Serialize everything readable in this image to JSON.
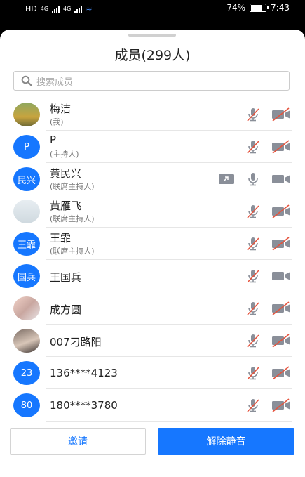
{
  "status_bar": {
    "left_items": [
      "HD",
      "4G",
      "4G"
    ],
    "battery": "74%",
    "time": "7:43"
  },
  "header": {
    "title": "成员(299人)"
  },
  "search": {
    "placeholder": "搜索成员"
  },
  "members": [
    {
      "name": "梅洁",
      "role": "(我)",
      "avatar": "photo-landscape",
      "mic": "muted",
      "camera": "off",
      "sharing": false
    },
    {
      "name": "P",
      "role": "(主持人)",
      "avatar_text": "P",
      "mic": "muted",
      "camera": "off",
      "sharing": false
    },
    {
      "name": "黄民兴",
      "role": "(联席主持人)",
      "avatar_text": "民兴",
      "mic": "on",
      "camera": "on",
      "sharing": true
    },
    {
      "name": "黄雁飞",
      "role": "(联席主持人)",
      "avatar": "photo-mountain",
      "mic": "muted",
      "camera": "off",
      "sharing": false
    },
    {
      "name": "王霏",
      "role": "(联席主持人)",
      "avatar_text": "王霏",
      "mic": "muted",
      "camera": "off",
      "sharing": false
    },
    {
      "name": "王国兵",
      "role": "",
      "avatar_text": "国兵",
      "mic": "muted",
      "camera": "on",
      "sharing": false
    },
    {
      "name": " 成方圆",
      "role": "",
      "avatar": "photo-girl",
      "mic": "muted",
      "camera": "off",
      "sharing": false
    },
    {
      "name": "007刁路阳",
      "role": "",
      "avatar": "photo-person",
      "mic": "muted",
      "camera": "off",
      "sharing": false
    },
    {
      "name": "136****4123",
      "role": "",
      "avatar_text": "23",
      "mic": "muted",
      "camera": "off",
      "sharing": false
    },
    {
      "name": "180****3780",
      "role": "",
      "avatar_text": "80",
      "mic": "muted",
      "camera": "off",
      "sharing": false
    }
  ],
  "actions": {
    "invite": "邀请",
    "unmute_all": "解除静音"
  },
  "colors": {
    "accent": "#1677ff",
    "muted_slash": "#e5533d",
    "icon_gray": "#8a8f99"
  }
}
